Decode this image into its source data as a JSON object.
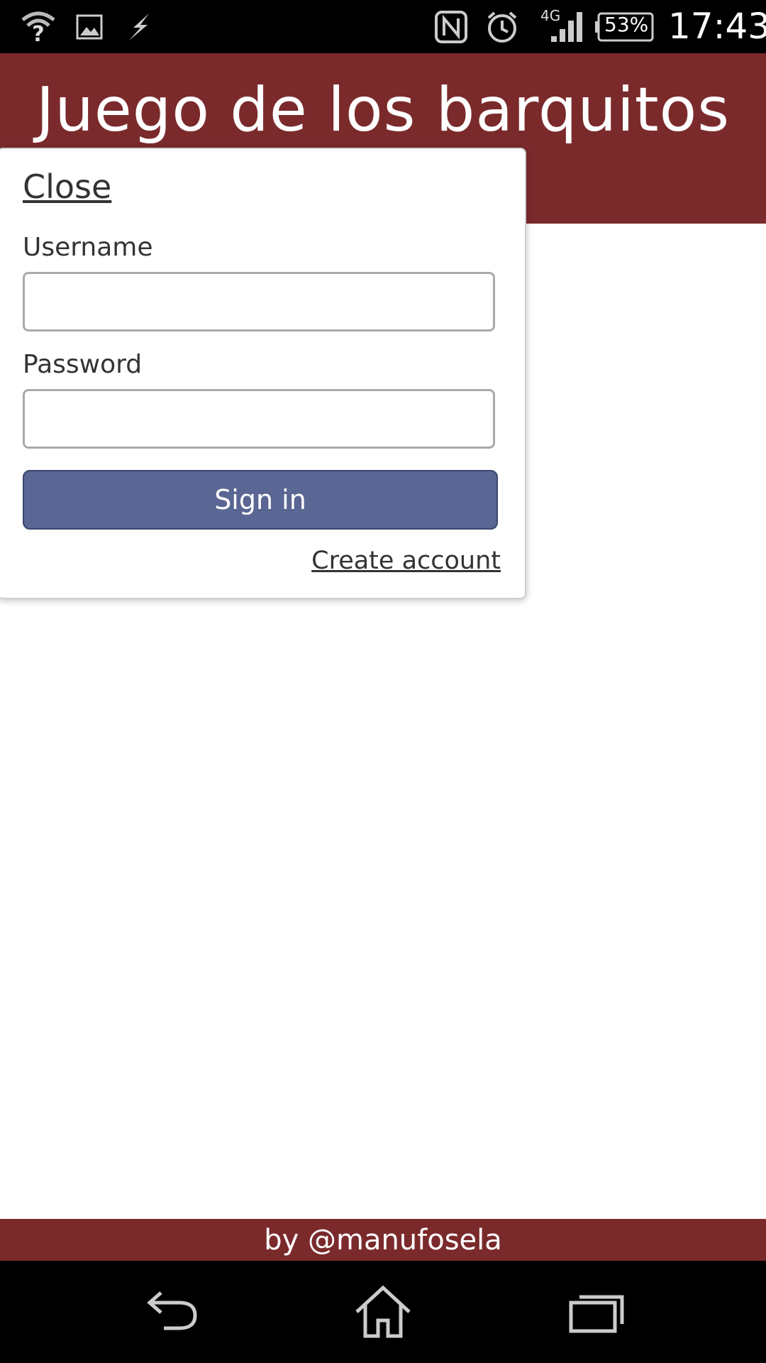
{
  "status_bar": {
    "battery": "53%",
    "network": "4G",
    "time": "17:43",
    "icons": [
      "wifi-question-icon",
      "image-icon",
      "flash-icon",
      "nfc-icon",
      "alarm-icon",
      "signal-icon",
      "battery-icon"
    ]
  },
  "header": {
    "title": "Juego de los barquitos",
    "bg_color": "#7b2a2c"
  },
  "login_popup": {
    "close_label": "Close",
    "username_label": "Username",
    "username_value": "",
    "password_label": "Password",
    "password_value": "",
    "signin_label": "Sign in",
    "signin_color": "#5a6693",
    "create_account_label": "Create account"
  },
  "footer": {
    "text": "by @manufosela"
  },
  "nav_bar": {
    "icons": [
      "back-icon",
      "home-icon",
      "recent-apps-icon"
    ]
  }
}
